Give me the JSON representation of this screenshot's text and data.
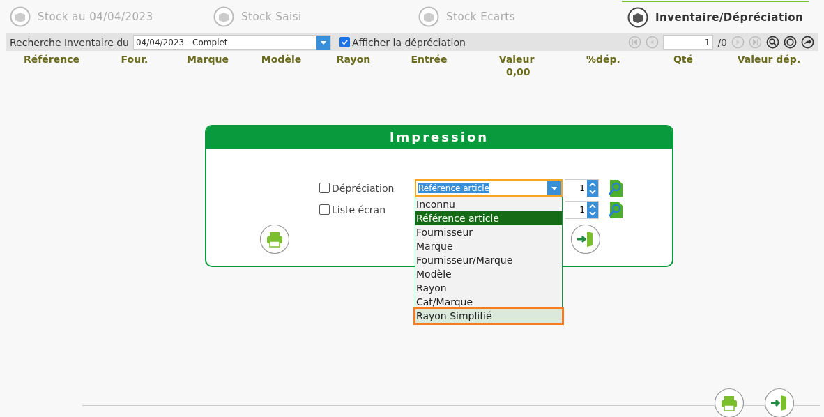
{
  "tabs": [
    {
      "label": "Stock au 04/04/2023",
      "selected": false
    },
    {
      "label": "Stock Saisi",
      "selected": false
    },
    {
      "label": "Stock Ecarts",
      "selected": false
    },
    {
      "label": "Inventaire/Dépréciation",
      "selected": true
    }
  ],
  "toolbar": {
    "search_label": "Recherche Inventaire du",
    "inventory_select": "04/04/2023 - Complet",
    "show_depreciation": {
      "label": "Afficher la dépréciation",
      "checked": true
    },
    "page": "1",
    "page_total": "/0"
  },
  "table": {
    "columns": [
      "Référence",
      "Four.",
      "Marque",
      "Modèle",
      "Rayon",
      "Entrée",
      "Valeur",
      "%dép.",
      "Qté",
      "Valeur dép."
    ],
    "total_value": "0,00"
  },
  "print_dialog": {
    "title": "Impression",
    "options": [
      {
        "label": "Dépréciation",
        "checked": false,
        "sort_value": "Référence article",
        "copies": "1"
      },
      {
        "label": "Liste écran",
        "checked": false,
        "copies": "1"
      }
    ],
    "dropdown": [
      {
        "label": "Inconnu",
        "selected": false,
        "highlighted": false
      },
      {
        "label": "Référence article",
        "selected": true,
        "highlighted": false
      },
      {
        "label": "Fournisseur",
        "selected": false,
        "highlighted": false
      },
      {
        "label": "Marque",
        "selected": false,
        "highlighted": false
      },
      {
        "label": "Fournisseur/Marque",
        "selected": false,
        "highlighted": false
      },
      {
        "label": "Modèle",
        "selected": false,
        "highlighted": false
      },
      {
        "label": "Rayon",
        "selected": false,
        "highlighted": false
      },
      {
        "label": "Cat/Marque",
        "selected": false,
        "highlighted": false
      },
      {
        "label": "Rayon Simplifié",
        "selected": false,
        "highlighted": true
      }
    ]
  }
}
